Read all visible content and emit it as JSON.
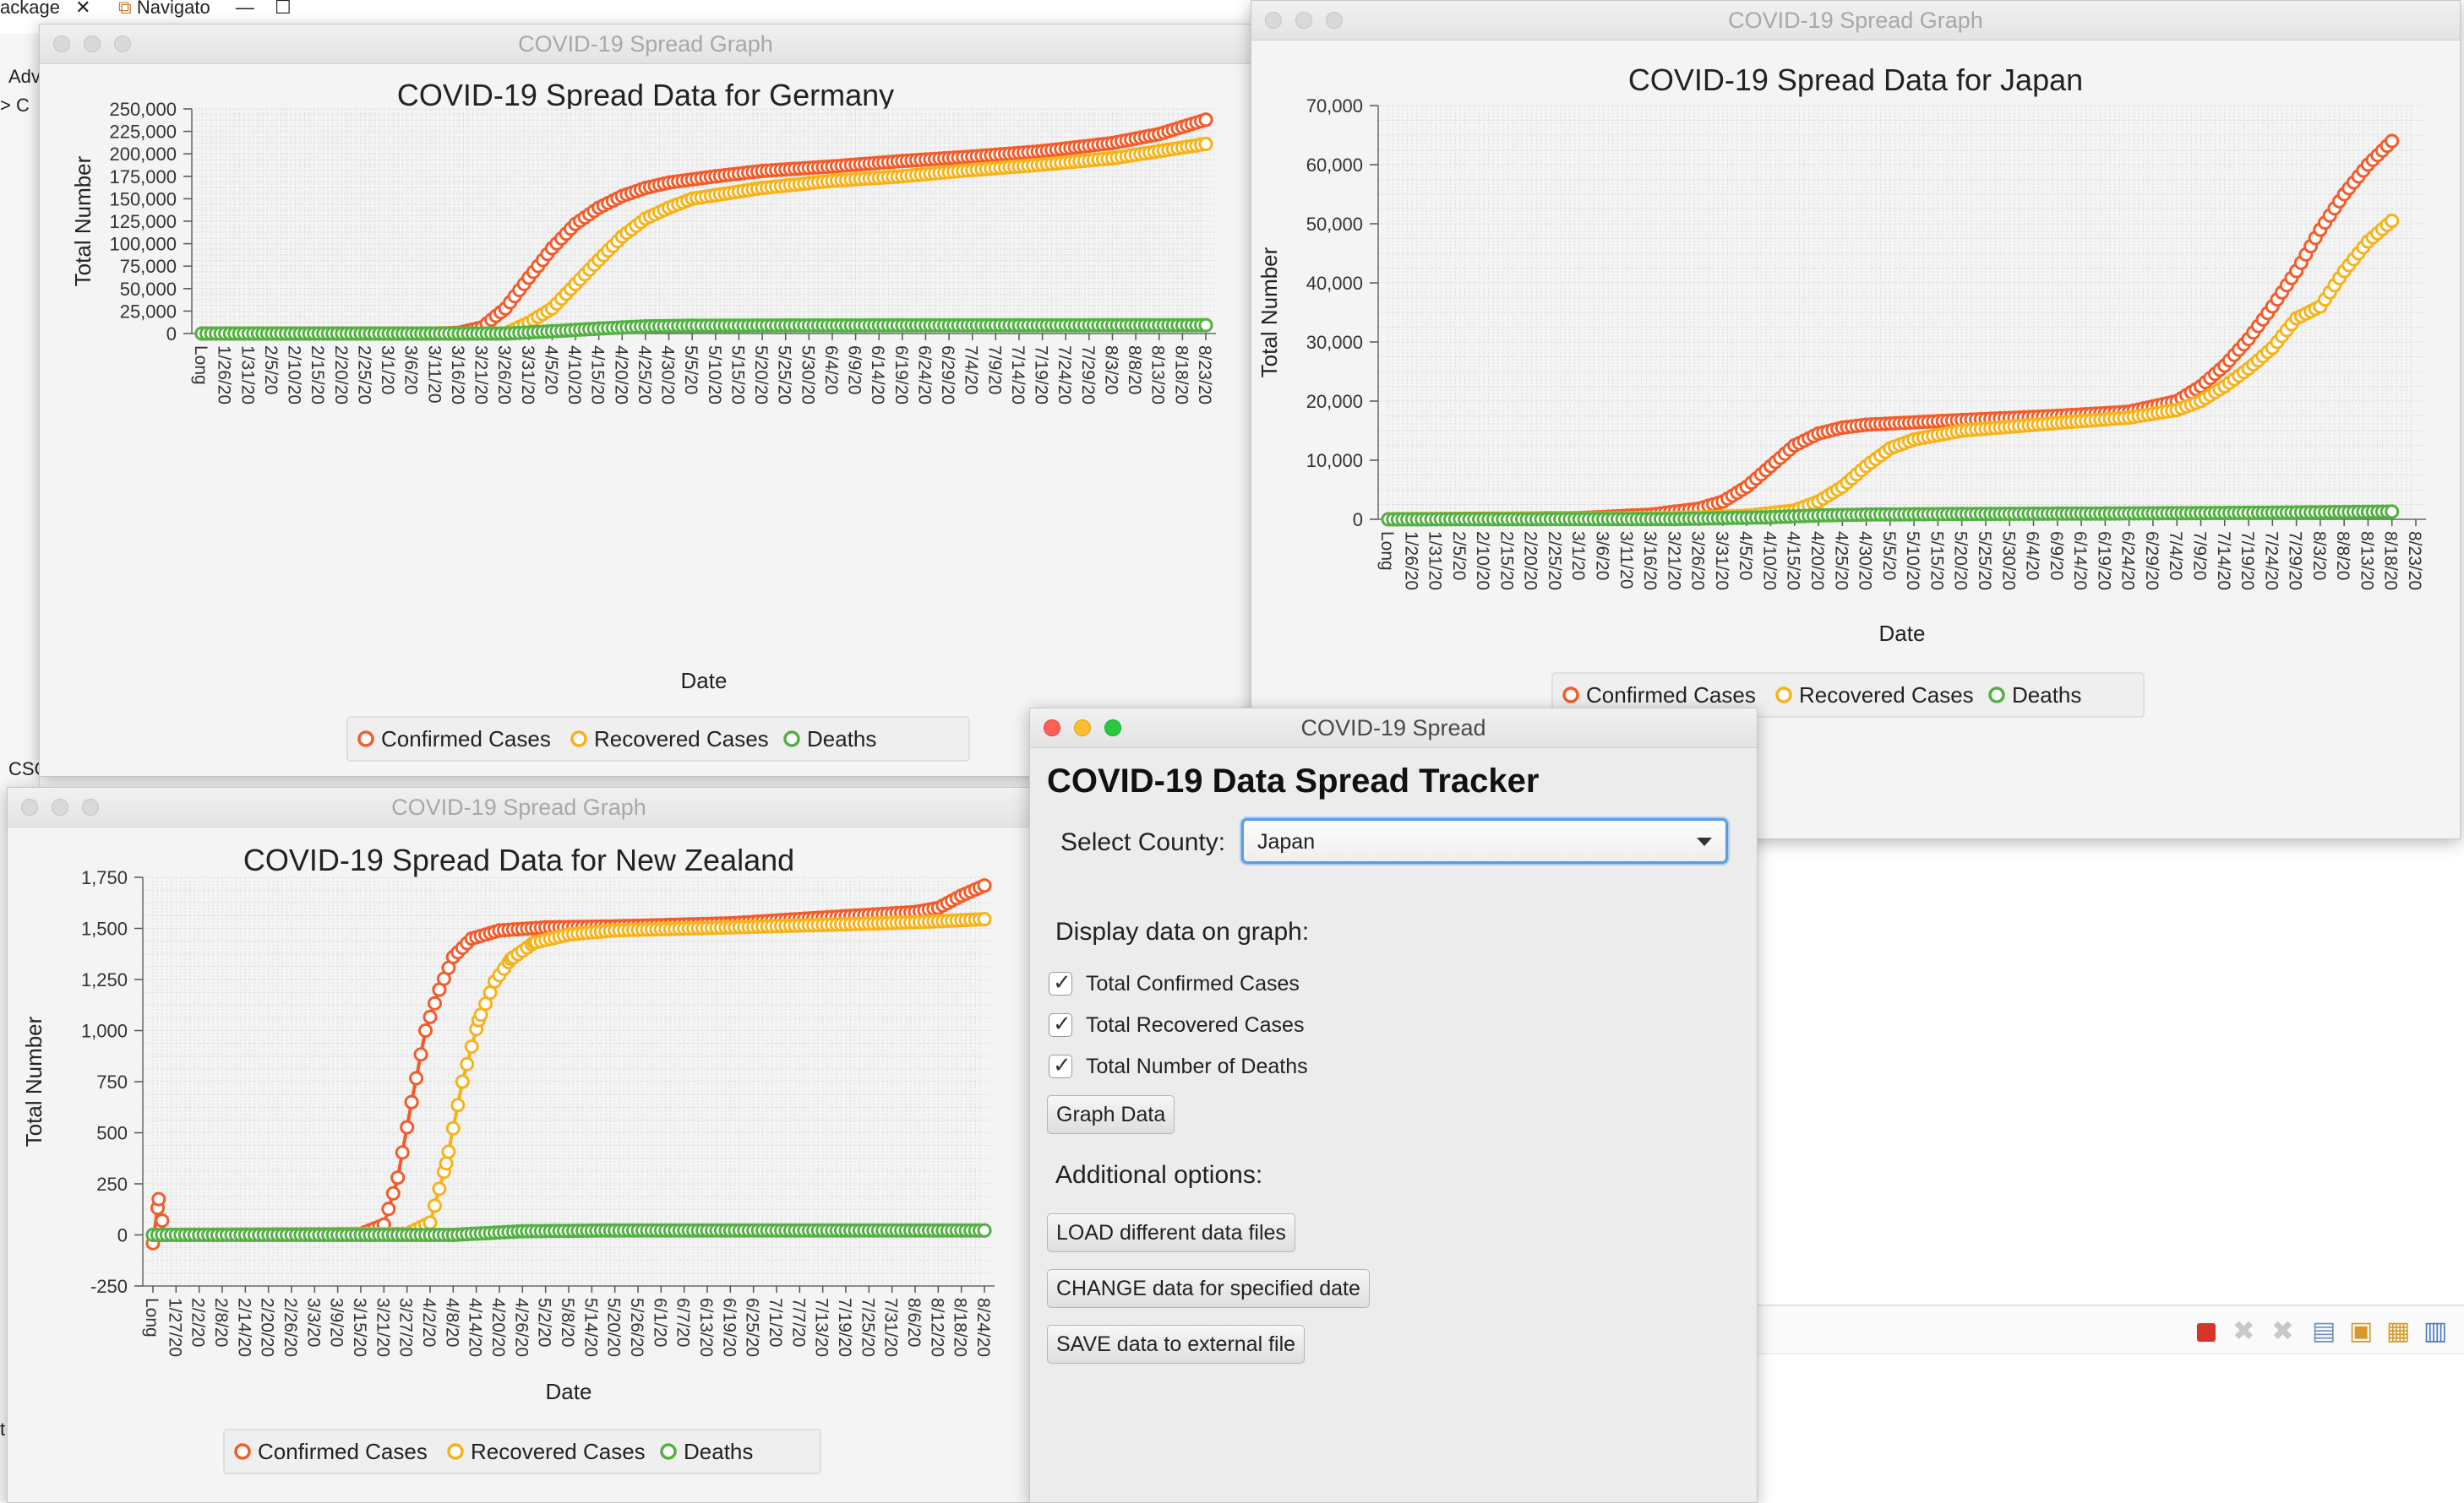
{
  "background_app": {
    "tabs": [
      "ackage",
      "Navigato"
    ],
    "sidebar_fragments": [
      "Adv",
      "> C",
      "CSC",
      "t"
    ]
  },
  "colors": {
    "confirmed": "#f45b2a",
    "recovered": "#f7b21a",
    "deaths": "#53b043"
  },
  "windows": {
    "germany": {
      "window_title": "COVID-19 Spread Graph"
    },
    "japan": {
      "window_title": "COVID-19 Spread Graph"
    },
    "nz": {
      "window_title": "COVID-19 Spread Graph"
    }
  },
  "chart_data": [
    {
      "id": "germany",
      "type": "line",
      "title": "COVID-19 Spread Data for Germany",
      "xlabel": "Date",
      "ylabel": "Total Number",
      "ylim": [
        0,
        250000
      ],
      "yticks": [
        "0",
        "25,000",
        "50,000",
        "75,000",
        "100,000",
        "125,000",
        "150,000",
        "175,000",
        "200,000",
        "225,000",
        "250,000"
      ],
      "x_tick_labels": [
        "Long",
        "1/26/20",
        "1/31/20",
        "2/5/20",
        "2/10/20",
        "2/15/20",
        "2/20/20",
        "2/25/20",
        "3/1/20",
        "3/6/20",
        "3/11/20",
        "3/16/20",
        "3/21/20",
        "3/26/20",
        "3/31/20",
        "4/5/20",
        "4/10/20",
        "4/15/20",
        "4/20/20",
        "4/25/20",
        "4/30/20",
        "5/5/20",
        "5/10/20",
        "5/15/20",
        "5/20/20",
        "5/25/20",
        "5/30/20",
        "6/4/20",
        "6/9/20",
        "6/14/20",
        "6/19/20",
        "6/24/20",
        "6/29/20",
        "7/4/20",
        "7/9/20",
        "7/14/20",
        "7/19/20",
        "7/24/20",
        "7/29/20",
        "8/3/20",
        "8/8/20",
        "8/13/20",
        "8/18/20",
        "8/23/20"
      ],
      "legend": [
        "Confirmed Cases",
        "Recovered Cases",
        "Deaths"
      ],
      "grid": true,
      "series": [
        {
          "name": "Confirmed Cases",
          "key": "confirmed",
          "points": [
            [
              0,
              0
            ],
            [
              10,
              0
            ],
            [
              11,
              800
            ],
            [
              12,
              7000
            ],
            [
              13,
              28000
            ],
            [
              14,
              62000
            ],
            [
              15,
              95000
            ],
            [
              16,
              122000
            ],
            [
              17,
              140000
            ],
            [
              18,
              153000
            ],
            [
              19,
              162000
            ],
            [
              20,
              168000
            ],
            [
              22,
              175000
            ],
            [
              24,
              181000
            ],
            [
              27,
              186000
            ],
            [
              30,
              192000
            ],
            [
              33,
              197000
            ],
            [
              36,
              203000
            ],
            [
              39,
              212000
            ],
            [
              41,
              222000
            ],
            [
              42,
              230000
            ],
            [
              43,
              238000
            ]
          ]
        },
        {
          "name": "Recovered Cases",
          "key": "recovered",
          "points": [
            [
              0,
              0
            ],
            [
              13,
              0
            ],
            [
              14,
              12000
            ],
            [
              15,
              28000
            ],
            [
              16,
              55000
            ],
            [
              17,
              82000
            ],
            [
              18,
              108000
            ],
            [
              19,
              128000
            ],
            [
              20,
              140000
            ],
            [
              21,
              150000
            ],
            [
              24,
              162000
            ],
            [
              27,
              170000
            ],
            [
              30,
              175000
            ],
            [
              33,
              182000
            ],
            [
              36,
              188000
            ],
            [
              39,
              195000
            ],
            [
              41,
              203000
            ],
            [
              43,
              211000
            ]
          ]
        },
        {
          "name": "Deaths",
          "key": "deaths",
          "points": [
            [
              0,
              0
            ],
            [
              13,
              0
            ],
            [
              15,
              2500
            ],
            [
              17,
              5500
            ],
            [
              19,
              8000
            ],
            [
              21,
              8700
            ],
            [
              25,
              9000
            ],
            [
              30,
              9100
            ],
            [
              35,
              9200
            ],
            [
              40,
              9300
            ],
            [
              43,
              9300
            ]
          ]
        }
      ]
    },
    {
      "id": "japan",
      "type": "line",
      "title": "COVID-19 Spread Data for Japan",
      "xlabel": "Date",
      "ylabel": "Total Number",
      "ylim": [
        0,
        70000
      ],
      "yticks": [
        "0",
        "10,000",
        "20,000",
        "30,000",
        "40,000",
        "50,000",
        "60,000",
        "70,000"
      ],
      "x_tick_labels": [
        "Long",
        "1/26/20",
        "1/31/20",
        "2/5/20",
        "2/10/20",
        "2/15/20",
        "2/20/20",
        "2/25/20",
        "3/1/20",
        "3/6/20",
        "3/11/20",
        "3/16/20",
        "3/21/20",
        "3/26/20",
        "3/31/20",
        "4/5/20",
        "4/10/20",
        "4/15/20",
        "4/20/20",
        "4/25/20",
        "4/30/20",
        "5/5/20",
        "5/10/20",
        "5/15/20",
        "5/20/20",
        "5/25/20",
        "5/30/20",
        "6/4/20",
        "6/9/20",
        "6/14/20",
        "6/19/20",
        "6/24/20",
        "6/29/20",
        "7/4/20",
        "7/9/20",
        "7/14/20",
        "7/19/20",
        "7/24/20",
        "7/29/20",
        "8/3/20",
        "8/8/20",
        "8/13/20",
        "8/18/20",
        "8/23/20"
      ],
      "legend": [
        "Confirmed Cases",
        "Recovered Cases",
        "Deaths"
      ],
      "grid": true,
      "series": [
        {
          "name": "Confirmed Cases",
          "key": "confirmed",
          "points": [
            [
              0,
              0
            ],
            [
              8,
              200
            ],
            [
              11,
              800
            ],
            [
              13,
              1800
            ],
            [
              14,
              3000
            ],
            [
              15,
              5500
            ],
            [
              16,
              9000
            ],
            [
              17,
              12500
            ],
            [
              18,
              14500
            ],
            [
              19,
              15500
            ],
            [
              20,
              16000
            ],
            [
              24,
              16800
            ],
            [
              28,
              17500
            ],
            [
              31,
              18200
            ],
            [
              33,
              20000
            ],
            [
              34,
              22500
            ],
            [
              35,
              26000
            ],
            [
              36,
              30500
            ],
            [
              37,
              36000
            ],
            [
              38,
              42000
            ],
            [
              39,
              49000
            ],
            [
              40,
              55000
            ],
            [
              41,
              60000
            ],
            [
              42,
              64000
            ]
          ]
        },
        {
          "name": "Recovered Cases",
          "key": "recovered",
          "points": [
            [
              0,
              0
            ],
            [
              12,
              200
            ],
            [
              15,
              600
            ],
            [
              17,
              1500
            ],
            [
              18,
              3000
            ],
            [
              19,
              5500
            ],
            [
              20,
              9000
            ],
            [
              21,
              12000
            ],
            [
              22,
              13500
            ],
            [
              24,
              15000
            ],
            [
              28,
              16300
            ],
            [
              31,
              17200
            ],
            [
              33,
              18500
            ],
            [
              34,
              20000
            ],
            [
              35,
              22500
            ],
            [
              36,
              25500
            ],
            [
              37,
              29000
            ],
            [
              38,
              34000
            ],
            [
              39,
              36000
            ],
            [
              40,
              42000
            ],
            [
              41,
              47000
            ],
            [
              42,
              50500
            ]
          ]
        },
        {
          "name": "Deaths",
          "key": "deaths",
          "points": [
            [
              0,
              0
            ],
            [
              12,
              40
            ],
            [
              16,
              350
            ],
            [
              18,
              650
            ],
            [
              20,
              800
            ],
            [
              24,
              900
            ],
            [
              30,
              980
            ],
            [
              34,
              1050
            ],
            [
              38,
              1150
            ],
            [
              42,
              1300
            ]
          ]
        }
      ]
    },
    {
      "id": "nz",
      "type": "line",
      "title": "COVID-19 Spread Data for New Zealand",
      "xlabel": "Date",
      "ylabel": "Total Number",
      "ylim": [
        -250,
        1750
      ],
      "yticks": [
        "-250",
        "0",
        "250",
        "500",
        "750",
        "1,000",
        "1,250",
        "1,500",
        "1,750"
      ],
      "x_tick_labels": [
        "Long",
        "1/27/20",
        "2/2/20",
        "2/8/20",
        "2/14/20",
        "2/20/20",
        "2/26/20",
        "3/3/20",
        "3/9/20",
        "3/15/20",
        "3/21/20",
        "3/27/20",
        "4/2/20",
        "4/8/20",
        "4/14/20",
        "4/20/20",
        "4/26/20",
        "5/2/20",
        "5/8/20",
        "5/14/20",
        "5/20/20",
        "5/26/20",
        "6/1/20",
        "6/7/20",
        "6/13/20",
        "6/19/20",
        "6/25/20",
        "7/1/20",
        "7/7/20",
        "7/13/20",
        "7/19/20",
        "7/25/20",
        "7/31/20",
        "8/6/20",
        "8/12/20",
        "8/18/20",
        "8/24/20"
      ],
      "legend": [
        "Confirmed Cases",
        "Recovered Cases",
        "Deaths"
      ],
      "grid": true,
      "series": [
        {
          "name": "Confirmed Cases",
          "key": "confirmed",
          "points": [
            [
              0,
              -40
            ],
            [
              0.25,
              175
            ],
            [
              0.5,
              0
            ],
            [
              9,
              5
            ],
            [
              10,
              50
            ],
            [
              10.6,
              280
            ],
            [
              11.2,
              650
            ],
            [
              11.8,
              1000
            ],
            [
              12.4,
              1200
            ],
            [
              13,
              1360
            ],
            [
              13.8,
              1450
            ],
            [
              15,
              1490
            ],
            [
              17,
              1505
            ],
            [
              20,
              1510
            ],
            [
              25,
              1525
            ],
            [
              30,
              1560
            ],
            [
              33,
              1580
            ],
            [
              34,
              1600
            ],
            [
              35,
              1660
            ],
            [
              36,
              1710
            ]
          ]
        },
        {
          "name": "Recovered Cases",
          "key": "recovered",
          "points": [
            [
              0,
              0
            ],
            [
              11,
              5
            ],
            [
              12,
              60
            ],
            [
              12.7,
              350
            ],
            [
              13.4,
              750
            ],
            [
              14.1,
              1050
            ],
            [
              14.8,
              1240
            ],
            [
              15.5,
              1350
            ],
            [
              16.5,
              1430
            ],
            [
              18,
              1470
            ],
            [
              20,
              1490
            ],
            [
              25,
              1505
            ],
            [
              30,
              1520
            ],
            [
              33,
              1530
            ],
            [
              36,
              1545
            ]
          ]
        },
        {
          "name": "Deaths",
          "key": "deaths",
          "points": [
            [
              0,
              0
            ],
            [
              13,
              0
            ],
            [
              16,
              18
            ],
            [
              20,
              22
            ],
            [
              36,
              22
            ]
          ]
        }
      ]
    }
  ],
  "tracker": {
    "window_title": "COVID-19 Spread",
    "heading": "COVID-19 Data Spread Tracker",
    "select_label": "Select County:",
    "selected_country": "Japan",
    "display_label": "Display data on graph:",
    "checkboxes": [
      {
        "label": "Total Confirmed Cases",
        "checked": true
      },
      {
        "label": "Total Recovered Cases",
        "checked": true
      },
      {
        "label": "Total Number of Deaths",
        "checked": true
      }
    ],
    "graph_button": "Graph Data",
    "additional_label": "Additional options:",
    "buttons": [
      "LOAD different data files",
      "CHANGE data for specified date",
      "SAVE data to external file"
    ]
  }
}
